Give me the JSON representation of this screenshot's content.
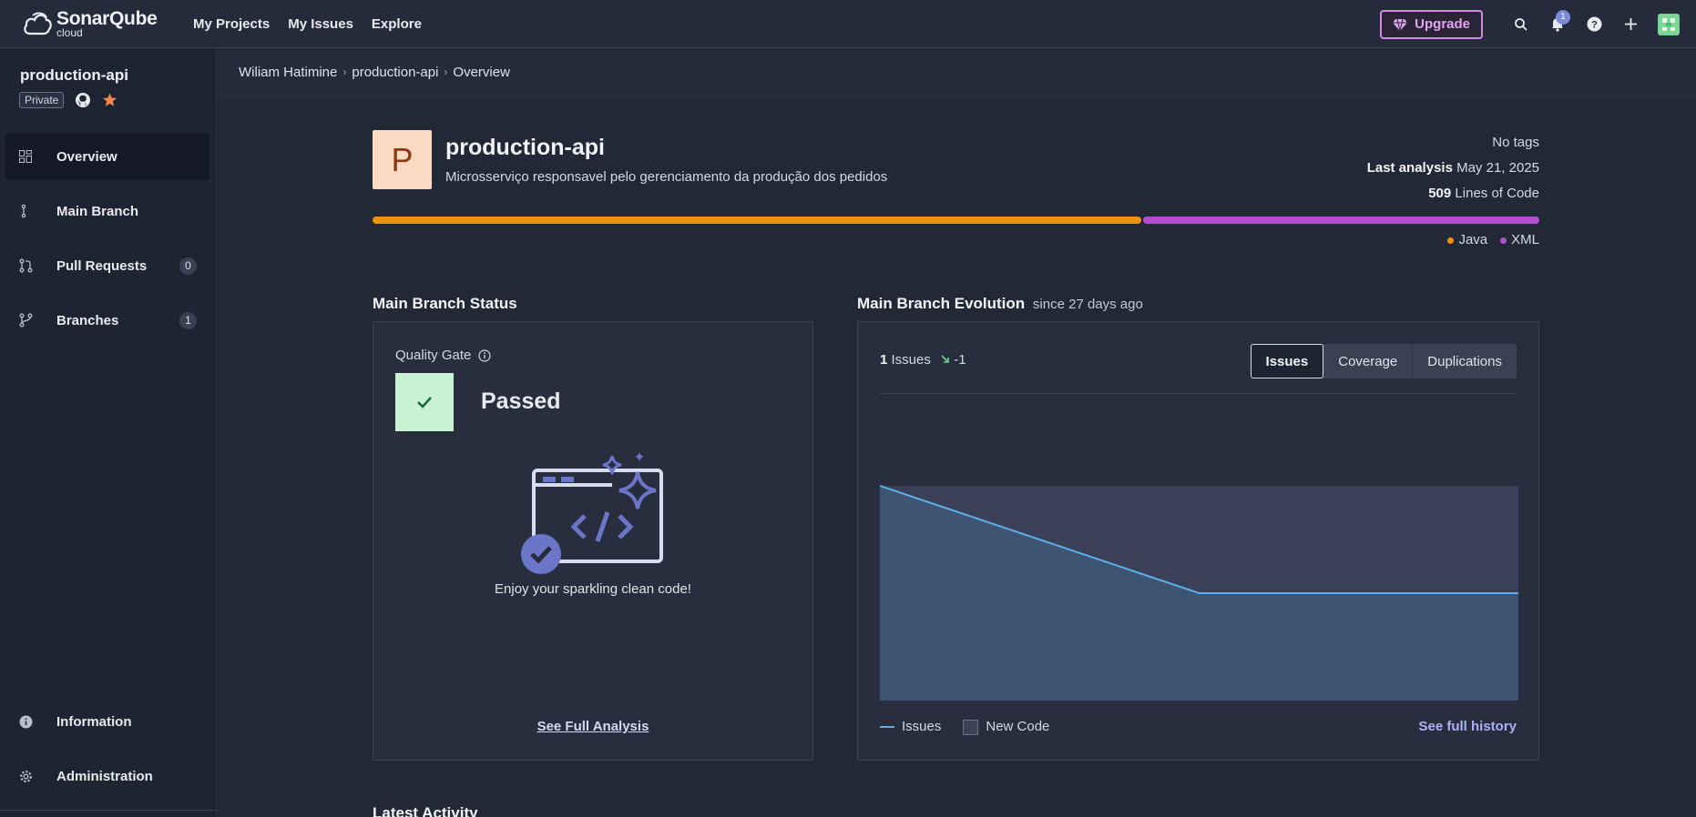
{
  "topbar": {
    "logo_main": "SonarQube",
    "logo_sub": "cloud",
    "nav": [
      "My Projects",
      "My Issues",
      "Explore"
    ],
    "upgrade_label": "Upgrade",
    "notification_count": "1",
    "icons": [
      "search-icon",
      "bell-icon",
      "help-icon",
      "plus-icon",
      "avatar"
    ]
  },
  "sidebar": {
    "project_name": "production-api",
    "visibility": "Private",
    "items": [
      {
        "label": "Overview",
        "icon": "dashboard-icon",
        "active": true
      },
      {
        "label": "Main Branch",
        "icon": "branch-icon"
      },
      {
        "label": "Pull Requests",
        "icon": "pull-request-icon",
        "count": "0"
      },
      {
        "label": "Branches",
        "icon": "branches-icon",
        "count": "1"
      }
    ],
    "bottom_items": [
      {
        "label": "Information",
        "icon": "info-icon"
      },
      {
        "label": "Administration",
        "icon": "gear-icon"
      }
    ]
  },
  "breadcrumb": [
    "Wiliam Hatimine",
    "production-api",
    "Overview"
  ],
  "project": {
    "avatar_letter": "P",
    "title": "production-api",
    "description": "Microsserviço responsavel pelo gerenciamento da produção dos pedidos",
    "tags": "No tags",
    "last_analysis_label": "Last analysis",
    "last_analysis_date": "May 21, 2025",
    "loc_value": "509",
    "loc_label": "Lines of Code",
    "languages": [
      {
        "name": "Java",
        "share": 0.66,
        "color": "#f0920e"
      },
      {
        "name": "XML",
        "share": 0.34,
        "color": "#b54fd0"
      }
    ]
  },
  "status": {
    "section_title": "Main Branch Status",
    "quality_gate_label": "Quality Gate",
    "quality_gate_status": "Passed",
    "message": "Enjoy your sparkling clean code!",
    "link": "See Full Analysis"
  },
  "evolution": {
    "section_title": "Main Branch Evolution",
    "since": "since 27 days ago",
    "issues_count": "1",
    "issues_label": "Issues",
    "issues_delta": "-1",
    "tabs": [
      "Issues",
      "Coverage",
      "Duplications"
    ],
    "selected_tab": "Issues",
    "legend_issues": "Issues",
    "legend_new_code": "New Code",
    "history_link": "See full history"
  },
  "chart_data": {
    "type": "line",
    "series": [
      {
        "name": "Issues",
        "values": [
          2,
          1,
          1
        ]
      }
    ],
    "x": [
      0,
      1,
      2
    ],
    "ylim": [
      0,
      2
    ]
  },
  "latest_activity_title": "Latest Activity"
}
